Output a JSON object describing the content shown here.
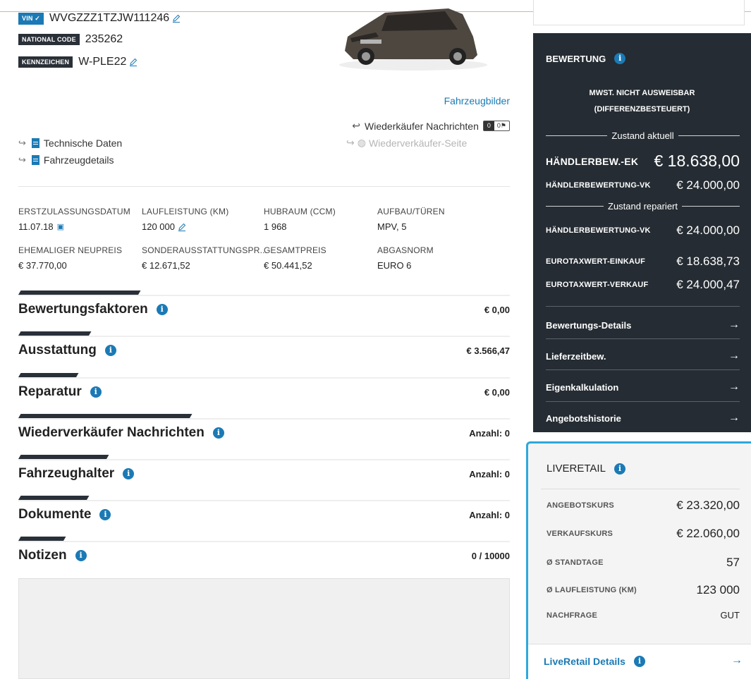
{
  "vehicle": {
    "vin_tag": "VIN ✓",
    "vin": "WVGZZZ1TZJW111246",
    "national_code_tag": "NATIONAL CODE",
    "national_code": "235262",
    "kennzeichen_tag": "KENNZEICHEN",
    "kennzeichen": "W-PLE22"
  },
  "links": {
    "fahrzeugbilder": "Fahrzeugbilder",
    "wiederkaeufer_nachrichten": "Wiederkäufer Nachrichten",
    "wiederkaeufer_count": "0",
    "wiederkaeufer_flag": "0",
    "wiederverkaeufer_seite": "Wiederverkäufer-Seite",
    "technische_daten": "Technische Daten",
    "fahrzeugdetails": "Fahrzeugdetails"
  },
  "specs": [
    {
      "label": "ERSTZULASSUNGSDATUM",
      "value": "11.07.18"
    },
    {
      "label": "LAUFLEISTUNG (KM)",
      "value": "120 000"
    },
    {
      "label": "HUBRAUM (CCM)",
      "value": "1 968"
    },
    {
      "label": "AUFBAU/TÜREN",
      "value": "MPV, 5"
    },
    {
      "label": "EHEMALIGER NEUPREIS",
      "value": "€ 37.770,00"
    },
    {
      "label": "SONDERAUSSTATTUNGSPR...",
      "value": "€ 12.671,52"
    },
    {
      "label": "GESAMTPREIS",
      "value": "€ 50.441,52"
    },
    {
      "label": "ABGASNORM",
      "value": "EURO 6"
    }
  ],
  "sections": [
    {
      "title": "Bewertungsfaktoren",
      "right": "€ 0,00"
    },
    {
      "title": "Ausstattung",
      "right": "€ 3.566,47"
    },
    {
      "title": "Reparatur",
      "right": "€ 0,00"
    },
    {
      "title": "Wiederverkäufer Nachrichten",
      "right": "Anzahl: 0"
    },
    {
      "title": "Fahrzeughalter",
      "right": "Anzahl: 0"
    },
    {
      "title": "Dokumente",
      "right": "Anzahl: 0"
    },
    {
      "title": "Notizen",
      "right": "0 / 10000"
    }
  ],
  "bewertung": {
    "title": "BEWERTUNG",
    "mwst_line1": "MWST. NICHT AUSWEISBAR",
    "mwst_line2": "(DIFFERENZBESTEUERT)",
    "zustand_aktuell": "Zustand aktuell",
    "haendler_ek_label": "HÄNDLERBEW.-EK",
    "haendler_ek_value": "€ 18.638,00",
    "haendler_vk_label": "HÄNDLERBEWERTUNG-VK",
    "haendler_vk_value": "€ 24.000,00",
    "zustand_repariert": "Zustand repariert",
    "rep_vk_label": "HÄNDLERBEWERTUNG-VK",
    "rep_vk_value": "€ 24.000,00",
    "eurotax_ek_label": "EUROTAXWERT-EINKAUF",
    "eurotax_ek_value": "€ 18.638,73",
    "eurotax_vk_label": "EUROTAXWERT-VERKAUF",
    "eurotax_vk_value": "€ 24.000,47",
    "nav": [
      "Bewertungs-Details",
      "Lieferzeitbew.",
      "Eigenkalkulation",
      "Angebotshistorie"
    ]
  },
  "liveretail": {
    "title": "LIVERETAIL",
    "rows": [
      {
        "label": "ANGEBOTSKURS",
        "value": "€ 23.320,00"
      },
      {
        "label": "VERKAUFSKURS",
        "value": "€ 22.060,00"
      },
      {
        "label": "Ø STANDTAGE",
        "value": "57"
      },
      {
        "label": "Ø LAUFLEISTUNG (KM)",
        "value": "123 000"
      },
      {
        "label": "NACHFRAGE",
        "value": "GUT"
      }
    ],
    "details_link": "LiveRetail Details"
  },
  "colors": {
    "accent": "#1b7ab5",
    "dark_panel": "#252c33",
    "highlight_border": "#2ea8dc"
  }
}
